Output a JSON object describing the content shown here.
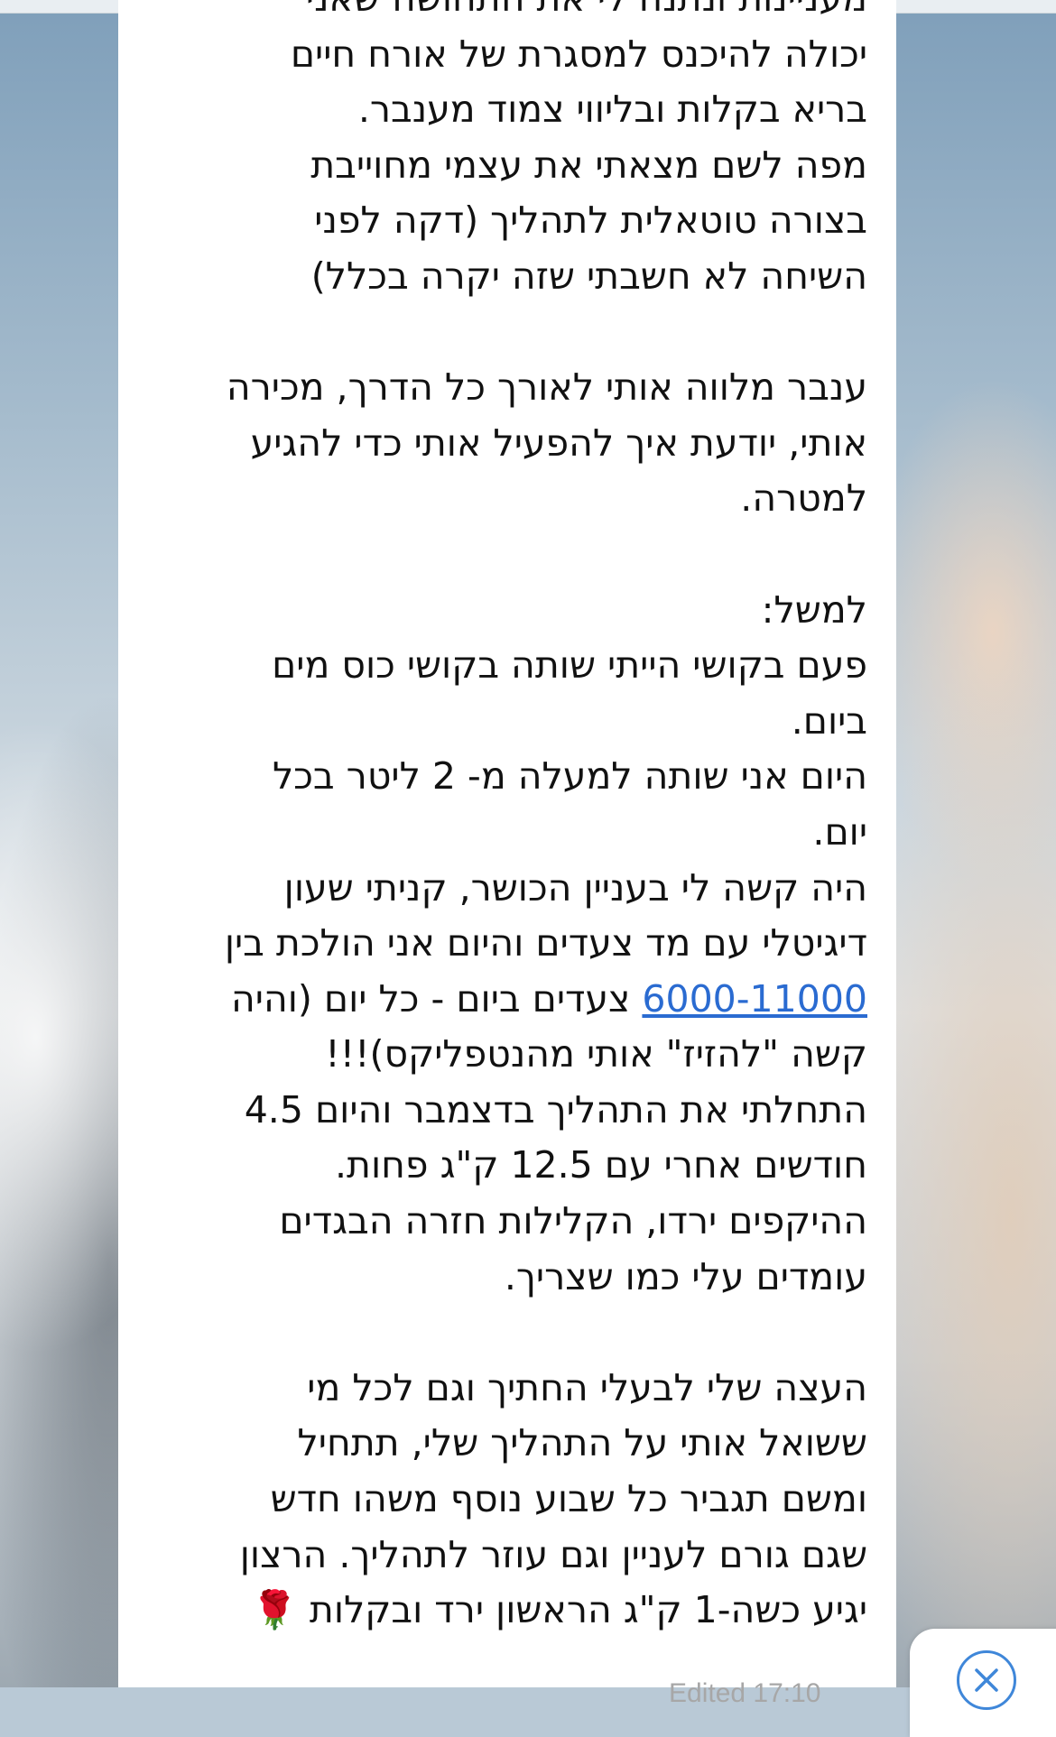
{
  "message": {
    "lines": [
      "מעניינות ונתנה לי את התחושה שאני",
      "יכולה להיכנס למסגרת של אורח חיים",
      "בריא בקלות ובליווי צמוד מענבר.",
      "מפה לשם מצאתי את עצמי מחוייבת",
      "בצורה טוטאלית לתהליך (דקה לפני",
      "השיחה לא חשבתי שזה יקרה בכלל)",
      "",
      "ענבר מלווה אותי לאורך כל הדרך, מכירה",
      "אותי, יודעת איך להפעיל אותי כדי להגיע",
      "למטרה.",
      "",
      "למשל:",
      "פעם בקושי הייתי שותה בקושי כוס מים",
      "ביום.",
      "היום אני שותה למעלה מ- 2 ליטר בכל",
      "יום.",
      "היה קשה לי בעניין הכושר, קניתי שעון",
      "דיגיטלי עם מד צעדים והיום אני הולכת בין",
      "LINK",
      "קשה \"להזיז\" אותי מהנטפליקס)!!!",
      "התחלתי את התהליך בדצמבר והיום 4.5",
      "חודשים אחרי עם 12.5 ק\"ג פחות.",
      "ההיקפים ירדו, הקלילות חזרה הבגדים",
      "עומדים עלי כמו שצריך.",
      "",
      "העצה שלי לבעלי החתיך וגם לכל מי",
      "ששואל אותי על התהליך שלי, תתחיל",
      "ומשם תגביר כל שבוע נוסף משהו חדש",
      "שגם גורם לעניין וגם עוזר לתהליך. הרצון",
      "יגיע כשה-1 ק\"ג הראשון ירד ובקלות 🌹"
    ],
    "link_line": {
      "link_text": "6000-11000",
      "after_text": " צעדים ביום - כל יום (והיה"
    },
    "meta": "Edited 17:10"
  },
  "colors": {
    "link": "#2a6bd1",
    "bubble": "#ffffff",
    "scroll_button_accent": "#3f87d9"
  },
  "icons": {
    "scroll_button": "close-icon"
  }
}
